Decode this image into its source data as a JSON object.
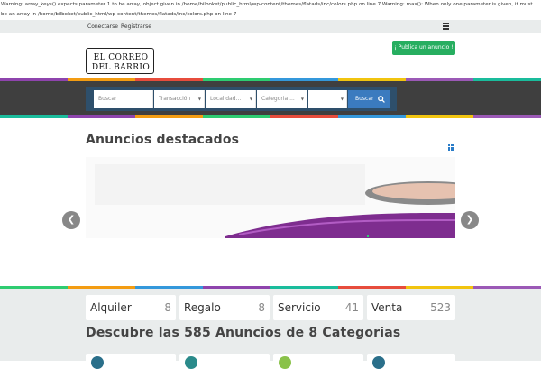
{
  "warning": "Warning: array_keys() expects parameter 1 to be array, object given in /home/bilboket/public_html/wp-content/themes/flatads/inc/colors.php on line 7 Warning: max(): When only one parameter is given, it must be an array in /home/bilboket/public_html/wp-content/themes/flatads/inc/colors.php on line 7",
  "topbar": {
    "login": "Conectarse",
    "register": "Registrarse",
    "menu_icon": "hamburger-icon"
  },
  "header": {
    "logo_line1": "EL CORREO",
    "logo_line2": "DEL BARRIO",
    "publish_label": "¡ Publica un anuncio !"
  },
  "search": {
    "placeholder": "Buscar",
    "transaction": "Transacción",
    "locality": "Localidad...",
    "category": "Categoria ...",
    "button": "Buscar",
    "icon": "search-icon"
  },
  "featured": {
    "title": "Anuncios destacados",
    "grid_icon": "grid-icon",
    "prev_icon": "chevron-left-icon",
    "next_icon": "chevron-right-icon"
  },
  "categories": [
    {
      "name": "Alquiler",
      "count": "8"
    },
    {
      "name": "Regalo",
      "count": "8"
    },
    {
      "name": "Servicio",
      "count": "41"
    },
    {
      "name": "Venta",
      "count": "523"
    }
  ],
  "discover": "Descubre las 585 Anuncios de 8 Categorias",
  "colors": {
    "accent_green": "#27ae60",
    "search_blue": "#3b7bbf",
    "stripe": [
      "#8e44ad",
      "#f39c12",
      "#e74c3c",
      "#2ecc71",
      "#3498db",
      "#f1c40f",
      "#9b59b6",
      "#1abc9c"
    ]
  }
}
